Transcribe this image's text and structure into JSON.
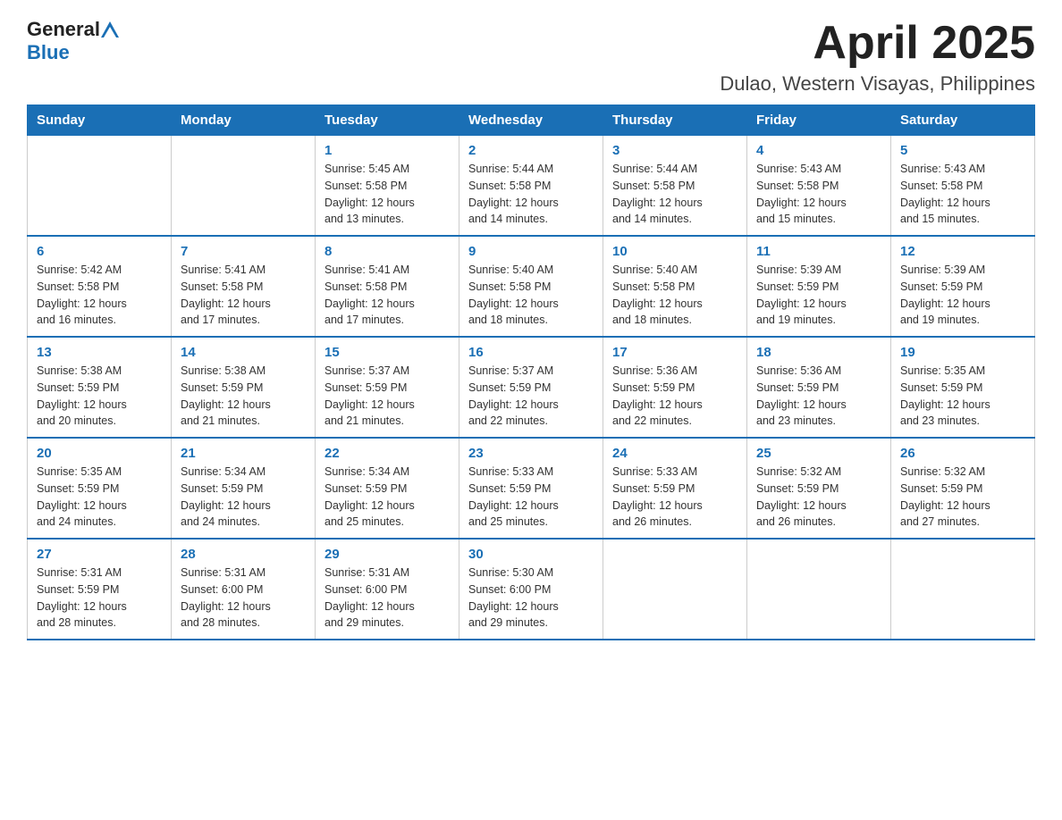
{
  "header": {
    "logo_general": "General",
    "logo_blue": "Blue",
    "title": "April 2025",
    "subtitle": "Dulao, Western Visayas, Philippines"
  },
  "days_of_week": [
    "Sunday",
    "Monday",
    "Tuesday",
    "Wednesday",
    "Thursday",
    "Friday",
    "Saturday"
  ],
  "weeks": [
    [
      {
        "day": "",
        "info": ""
      },
      {
        "day": "",
        "info": ""
      },
      {
        "day": "1",
        "info": "Sunrise: 5:45 AM\nSunset: 5:58 PM\nDaylight: 12 hours\nand 13 minutes."
      },
      {
        "day": "2",
        "info": "Sunrise: 5:44 AM\nSunset: 5:58 PM\nDaylight: 12 hours\nand 14 minutes."
      },
      {
        "day": "3",
        "info": "Sunrise: 5:44 AM\nSunset: 5:58 PM\nDaylight: 12 hours\nand 14 minutes."
      },
      {
        "day": "4",
        "info": "Sunrise: 5:43 AM\nSunset: 5:58 PM\nDaylight: 12 hours\nand 15 minutes."
      },
      {
        "day": "5",
        "info": "Sunrise: 5:43 AM\nSunset: 5:58 PM\nDaylight: 12 hours\nand 15 minutes."
      }
    ],
    [
      {
        "day": "6",
        "info": "Sunrise: 5:42 AM\nSunset: 5:58 PM\nDaylight: 12 hours\nand 16 minutes."
      },
      {
        "day": "7",
        "info": "Sunrise: 5:41 AM\nSunset: 5:58 PM\nDaylight: 12 hours\nand 17 minutes."
      },
      {
        "day": "8",
        "info": "Sunrise: 5:41 AM\nSunset: 5:58 PM\nDaylight: 12 hours\nand 17 minutes."
      },
      {
        "day": "9",
        "info": "Sunrise: 5:40 AM\nSunset: 5:58 PM\nDaylight: 12 hours\nand 18 minutes."
      },
      {
        "day": "10",
        "info": "Sunrise: 5:40 AM\nSunset: 5:58 PM\nDaylight: 12 hours\nand 18 minutes."
      },
      {
        "day": "11",
        "info": "Sunrise: 5:39 AM\nSunset: 5:59 PM\nDaylight: 12 hours\nand 19 minutes."
      },
      {
        "day": "12",
        "info": "Sunrise: 5:39 AM\nSunset: 5:59 PM\nDaylight: 12 hours\nand 19 minutes."
      }
    ],
    [
      {
        "day": "13",
        "info": "Sunrise: 5:38 AM\nSunset: 5:59 PM\nDaylight: 12 hours\nand 20 minutes."
      },
      {
        "day": "14",
        "info": "Sunrise: 5:38 AM\nSunset: 5:59 PM\nDaylight: 12 hours\nand 21 minutes."
      },
      {
        "day": "15",
        "info": "Sunrise: 5:37 AM\nSunset: 5:59 PM\nDaylight: 12 hours\nand 21 minutes."
      },
      {
        "day": "16",
        "info": "Sunrise: 5:37 AM\nSunset: 5:59 PM\nDaylight: 12 hours\nand 22 minutes."
      },
      {
        "day": "17",
        "info": "Sunrise: 5:36 AM\nSunset: 5:59 PM\nDaylight: 12 hours\nand 22 minutes."
      },
      {
        "day": "18",
        "info": "Sunrise: 5:36 AM\nSunset: 5:59 PM\nDaylight: 12 hours\nand 23 minutes."
      },
      {
        "day": "19",
        "info": "Sunrise: 5:35 AM\nSunset: 5:59 PM\nDaylight: 12 hours\nand 23 minutes."
      }
    ],
    [
      {
        "day": "20",
        "info": "Sunrise: 5:35 AM\nSunset: 5:59 PM\nDaylight: 12 hours\nand 24 minutes."
      },
      {
        "day": "21",
        "info": "Sunrise: 5:34 AM\nSunset: 5:59 PM\nDaylight: 12 hours\nand 24 minutes."
      },
      {
        "day": "22",
        "info": "Sunrise: 5:34 AM\nSunset: 5:59 PM\nDaylight: 12 hours\nand 25 minutes."
      },
      {
        "day": "23",
        "info": "Sunrise: 5:33 AM\nSunset: 5:59 PM\nDaylight: 12 hours\nand 25 minutes."
      },
      {
        "day": "24",
        "info": "Sunrise: 5:33 AM\nSunset: 5:59 PM\nDaylight: 12 hours\nand 26 minutes."
      },
      {
        "day": "25",
        "info": "Sunrise: 5:32 AM\nSunset: 5:59 PM\nDaylight: 12 hours\nand 26 minutes."
      },
      {
        "day": "26",
        "info": "Sunrise: 5:32 AM\nSunset: 5:59 PM\nDaylight: 12 hours\nand 27 minutes."
      }
    ],
    [
      {
        "day": "27",
        "info": "Sunrise: 5:31 AM\nSunset: 5:59 PM\nDaylight: 12 hours\nand 28 minutes."
      },
      {
        "day": "28",
        "info": "Sunrise: 5:31 AM\nSunset: 6:00 PM\nDaylight: 12 hours\nand 28 minutes."
      },
      {
        "day": "29",
        "info": "Sunrise: 5:31 AM\nSunset: 6:00 PM\nDaylight: 12 hours\nand 29 minutes."
      },
      {
        "day": "30",
        "info": "Sunrise: 5:30 AM\nSunset: 6:00 PM\nDaylight: 12 hours\nand 29 minutes."
      },
      {
        "day": "",
        "info": ""
      },
      {
        "day": "",
        "info": ""
      },
      {
        "day": "",
        "info": ""
      }
    ]
  ]
}
